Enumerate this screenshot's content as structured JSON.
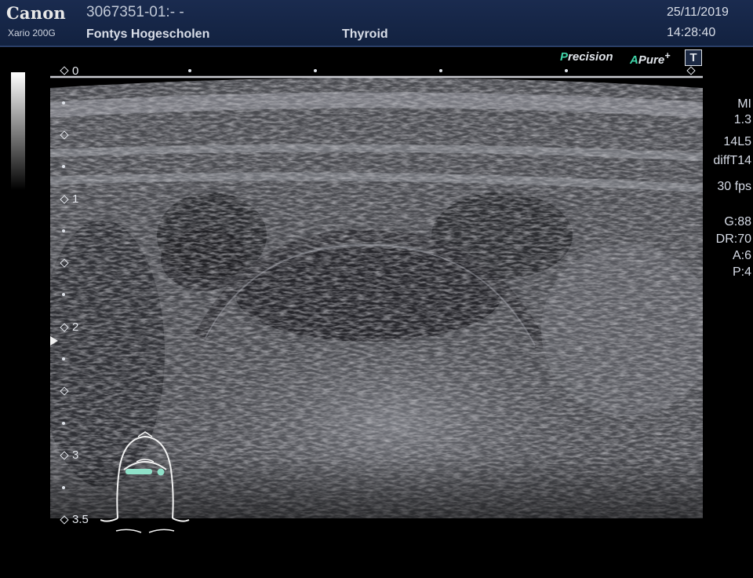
{
  "header": {
    "brand": "Canon",
    "model": "Xario 200G",
    "patient_id": "3067351-01:- -",
    "institution": "Fontys Hogescholen",
    "exam": "Thyroid",
    "date": "25/11/2019",
    "time": "14:28:40"
  },
  "logos": {
    "precision_initial": "P",
    "precision_rest": "recision",
    "apure_initial": "A",
    "apure_rest": "Pure",
    "apure_sup": "+",
    "badge": "T"
  },
  "depth_scale": {
    "labels": [
      "0",
      "1",
      "2",
      "3",
      "3.5"
    ],
    "unit_max_cm": 3.5
  },
  "params": [
    "MI",
    "1.3",
    "14L5",
    "diffT14",
    "30 fps",
    "G:88",
    "DR:70",
    "A:6",
    "P:4"
  ],
  "colors": {
    "header_bg": "#1a2b4f",
    "accent": "#40d4a8",
    "probe_marker": "#8fe0c8"
  },
  "icons": {
    "bodymark": "neck-bodymark-icon",
    "focus": "focus-marker-icon"
  }
}
